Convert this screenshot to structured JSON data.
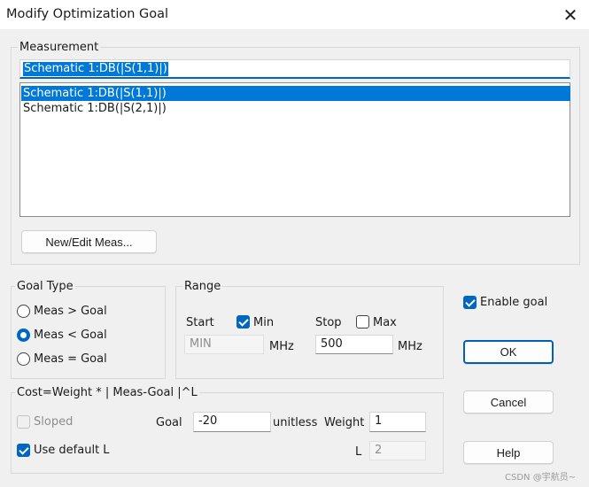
{
  "window": {
    "title": "Modify Optimization Goal"
  },
  "measurement": {
    "group_label": "Measurement",
    "combo_value": "Schematic 1:DB(|S(1,1)|)",
    "items": [
      {
        "label": "Schematic 1:DB(|S(1,1)|)"
      },
      {
        "label": "Schematic 1:DB(|S(2,1)|)"
      }
    ],
    "new_edit_label": "New/Edit Meas..."
  },
  "goal_type": {
    "group_label": "Goal Type",
    "options": [
      {
        "label": "Meas > Goal",
        "checked": false
      },
      {
        "label": "Meas < Goal",
        "checked": true
      },
      {
        "label": "Meas = Goal",
        "checked": false
      }
    ]
  },
  "range": {
    "group_label": "Range",
    "start_label": "Start",
    "min_label": "Min",
    "min_checked": true,
    "start_value": "MIN",
    "start_unit": "MHz",
    "stop_label": "Stop",
    "max_label": "Max",
    "max_checked": false,
    "stop_value": "500",
    "stop_unit": "MHz"
  },
  "cost": {
    "group_label": "Cost=Weight * | Meas-Goal |^L",
    "sloped_label": "Sloped",
    "sloped_checked": false,
    "goal_label": "Goal",
    "goal_value": "-20",
    "goal_unit": "unitless",
    "weight_label": "Weight",
    "weight_value": "1",
    "use_default_label": "Use default L",
    "use_default_checked": true,
    "l_label": "L",
    "l_value": "2"
  },
  "enable_goal": {
    "label": "Enable goal",
    "checked": true
  },
  "buttons": {
    "ok": "OK",
    "cancel": "Cancel",
    "help": "Help"
  },
  "watermark": "CSDN @宇航员~",
  "colors": {
    "accent": "#0067c0",
    "selection": "#0078d7",
    "default_border": "#005fb8",
    "dialog_bg": "#f0f0f0"
  }
}
